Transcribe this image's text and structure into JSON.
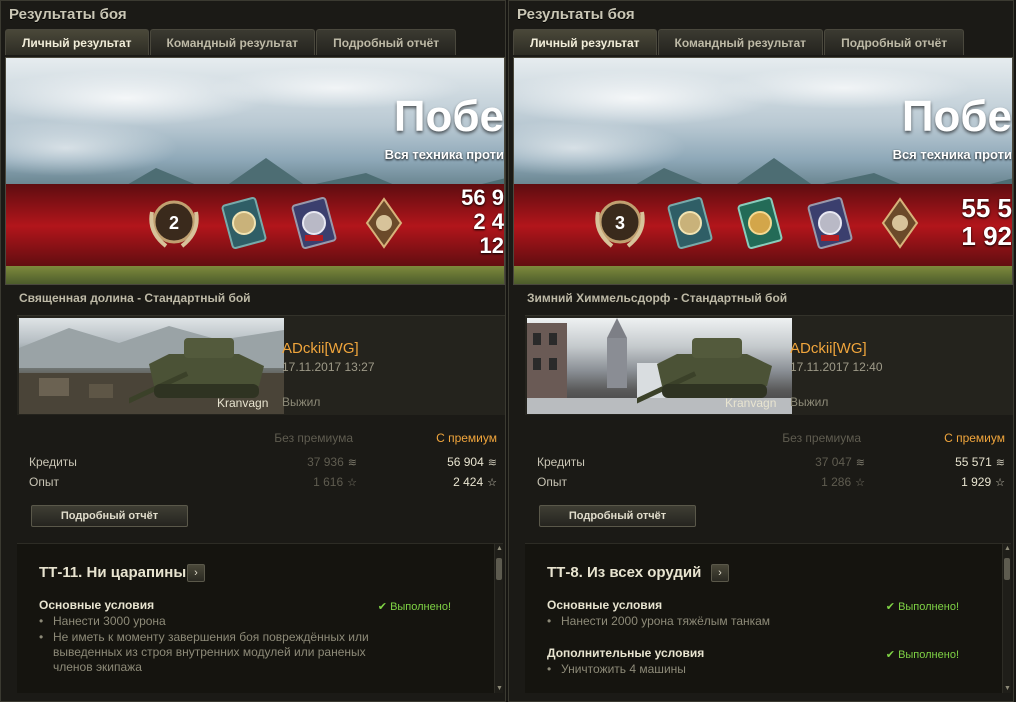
{
  "panels": [
    {
      "window_title": "Результаты боя",
      "tabs": [
        "Личный результат",
        "Командный результат",
        "Подробный отчёт"
      ],
      "active_tab": 0,
      "banner": {
        "title": "Побе",
        "subtitle": "Вся техника проти",
        "numbers": [
          "56 9",
          "2 4",
          "12"
        ],
        "medals": [
          {
            "name": "class-mastery-badge-icon",
            "label": "2"
          },
          {
            "name": "medal-icon-1",
            "label": ""
          },
          {
            "name": "medal-icon-2",
            "label": ""
          },
          {
            "name": "knuckles-badge-icon",
            "label": ""
          }
        ]
      },
      "map_mode": "Священная долина - Стандартный бой",
      "tank": "Kranvagn",
      "player": "ADckii[WG]",
      "datetime": "17.11.2017 13:27",
      "status": "Выжил",
      "stats": {
        "header_nonprem": "Без премиума",
        "header_prem": "С премиум",
        "rows": [
          {
            "label": "Кредиты",
            "nonprem": "37 936",
            "prem": "56 904",
            "icon": "credits-icon"
          },
          {
            "label": "Опыт",
            "nonprem": "1 616",
            "prem": "2 424",
            "icon": "xp-star-icon"
          }
        ]
      },
      "detail_button": "Подробный отчёт",
      "mission": {
        "title": "ТТ-11. Ни царапины",
        "sections": [
          {
            "title": "Основные условия",
            "done": "Выполнено!",
            "items": [
              "Нанести 3000 урона",
              "Не иметь к моменту завершения боя повреждённых или выведенных из строя внутренних модулей или раненых членов экипажа"
            ]
          }
        ]
      }
    },
    {
      "window_title": "Результаты боя",
      "tabs": [
        "Личный результат",
        "Командный результат",
        "Подробный отчёт"
      ],
      "active_tab": 0,
      "banner": {
        "title": "Побе",
        "subtitle": "Вся техника проти",
        "numbers": [
          "55 5",
          "1 92"
        ],
        "medals": [
          {
            "name": "class-mastery-badge-icon",
            "label": "3"
          },
          {
            "name": "medal-icon-1",
            "label": ""
          },
          {
            "name": "medal-icon-3",
            "label": ""
          },
          {
            "name": "medal-icon-2",
            "label": ""
          },
          {
            "name": "knuckles-badge-icon",
            "label": ""
          }
        ]
      },
      "map_mode": "Зимний Химмельсдорф - Стандартный бой",
      "tank": "Kranvagn",
      "player": "ADckii[WG]",
      "datetime": "17.11.2017 12:40",
      "status": "Выжил",
      "stats": {
        "header_nonprem": "Без премиума",
        "header_prem": "С премиум",
        "rows": [
          {
            "label": "Кредиты",
            "nonprem": "37 047",
            "prem": "55 571",
            "icon": "credits-icon"
          },
          {
            "label": "Опыт",
            "nonprem": "1 286",
            "prem": "1 929",
            "icon": "xp-star-icon"
          }
        ]
      },
      "detail_button": "Подробный отчёт",
      "mission": {
        "title": "ТТ-8. Из всех орудий",
        "sections": [
          {
            "title": "Основные условия",
            "done": "Выполнено!",
            "items": [
              "Нанести 2000 урона тяжёлым танкам"
            ]
          },
          {
            "title": "Дополнительные условия",
            "done": "Выполнено!",
            "items": [
              "Уничтожить 4 машины"
            ]
          }
        ]
      }
    }
  ],
  "colors": {
    "accent_orange": "#f0a53c",
    "success_green": "#7fd345",
    "banner_red": "#b2151b"
  }
}
